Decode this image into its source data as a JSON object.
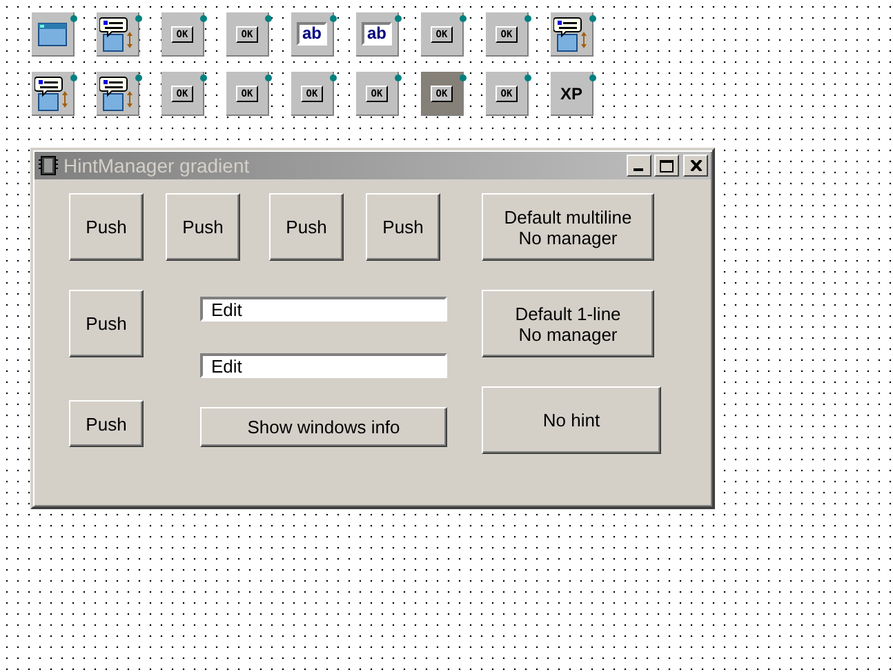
{
  "palette_rows": [
    [
      {
        "kind": "window",
        "selected": false
      },
      {
        "kind": "hint",
        "selected": false
      },
      {
        "kind": "button",
        "label": "OK",
        "selected": false
      },
      {
        "kind": "button",
        "label": "OK",
        "selected": false
      },
      {
        "kind": "edit",
        "label": "ab",
        "selected": false
      },
      {
        "kind": "edit",
        "label": "ab",
        "selected": false
      },
      {
        "kind": "button",
        "label": "OK",
        "selected": false
      },
      {
        "kind": "button",
        "label": "OK",
        "selected": false
      },
      {
        "kind": "hint",
        "selected": false
      }
    ],
    [
      {
        "kind": "hint",
        "selected": false
      },
      {
        "kind": "hint",
        "selected": false
      },
      {
        "kind": "button",
        "label": "OK",
        "selected": false
      },
      {
        "kind": "button",
        "label": "OK",
        "selected": false
      },
      {
        "kind": "button",
        "label": "OK",
        "selected": false
      },
      {
        "kind": "button",
        "label": "OK",
        "selected": false
      },
      {
        "kind": "button",
        "label": "OK",
        "selected": true
      },
      {
        "kind": "button",
        "label": "OK",
        "selected": false
      },
      {
        "kind": "xp",
        "label": "XP",
        "selected": false
      }
    ]
  ],
  "window": {
    "title": "HintManager gradient",
    "controls": [
      {
        "kind": "button",
        "label": "Push"
      },
      {
        "kind": "button",
        "label": "Push"
      },
      {
        "kind": "button",
        "label": "Push"
      },
      {
        "kind": "button",
        "label": "Push"
      },
      {
        "kind": "button",
        "label": "Default multiline\nNo manager"
      },
      {
        "kind": "button",
        "label": "Push"
      },
      {
        "kind": "edit",
        "value": "Edit"
      },
      {
        "kind": "button",
        "label": "Default 1-line\nNo manager"
      },
      {
        "kind": "edit",
        "value": "Edit"
      },
      {
        "kind": "button",
        "label": "Push"
      },
      {
        "kind": "button",
        "label": "Show windows info"
      },
      {
        "kind": "button",
        "label": "No hint"
      }
    ]
  }
}
